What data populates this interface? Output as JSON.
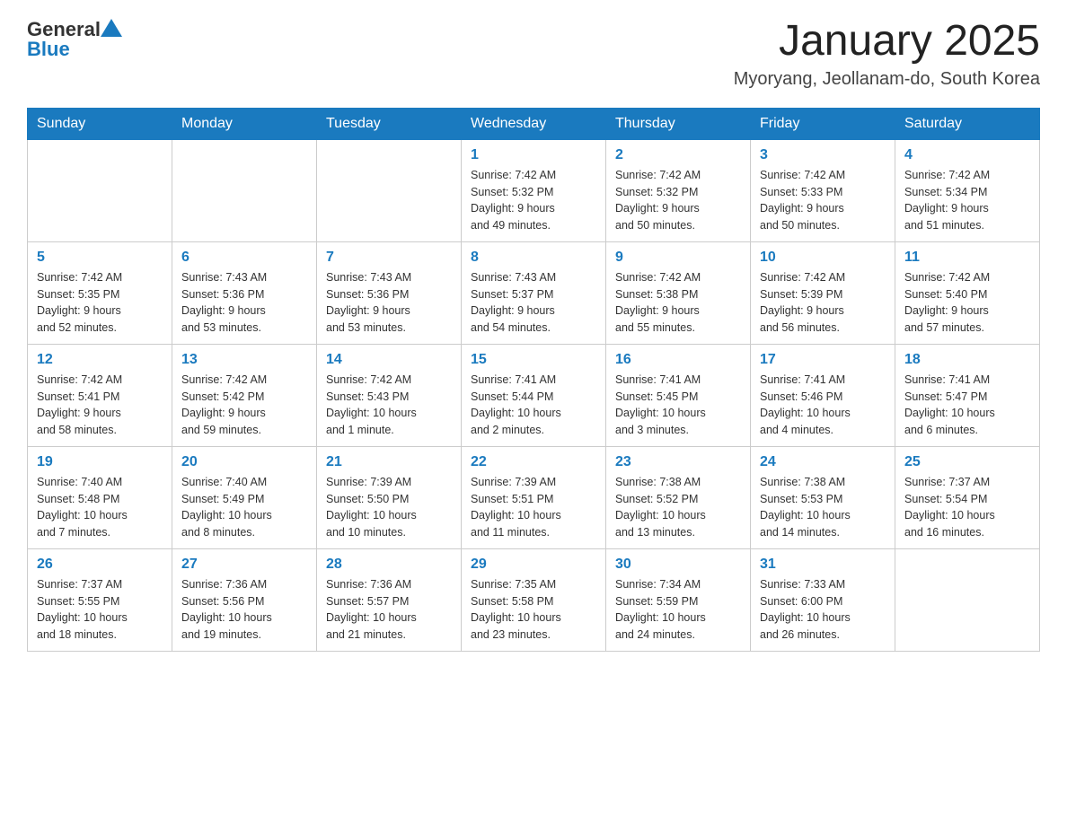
{
  "header": {
    "logo": {
      "general": "General",
      "blue": "Blue"
    },
    "title": "January 2025",
    "location": "Myoryang, Jeollanam-do, South Korea"
  },
  "weekdays": [
    "Sunday",
    "Monday",
    "Tuesday",
    "Wednesday",
    "Thursday",
    "Friday",
    "Saturday"
  ],
  "weeks": [
    [
      {
        "day": "",
        "info": ""
      },
      {
        "day": "",
        "info": ""
      },
      {
        "day": "",
        "info": ""
      },
      {
        "day": "1",
        "info": "Sunrise: 7:42 AM\nSunset: 5:32 PM\nDaylight: 9 hours\nand 49 minutes."
      },
      {
        "day": "2",
        "info": "Sunrise: 7:42 AM\nSunset: 5:32 PM\nDaylight: 9 hours\nand 50 minutes."
      },
      {
        "day": "3",
        "info": "Sunrise: 7:42 AM\nSunset: 5:33 PM\nDaylight: 9 hours\nand 50 minutes."
      },
      {
        "day": "4",
        "info": "Sunrise: 7:42 AM\nSunset: 5:34 PM\nDaylight: 9 hours\nand 51 minutes."
      }
    ],
    [
      {
        "day": "5",
        "info": "Sunrise: 7:42 AM\nSunset: 5:35 PM\nDaylight: 9 hours\nand 52 minutes."
      },
      {
        "day": "6",
        "info": "Sunrise: 7:43 AM\nSunset: 5:36 PM\nDaylight: 9 hours\nand 53 minutes."
      },
      {
        "day": "7",
        "info": "Sunrise: 7:43 AM\nSunset: 5:36 PM\nDaylight: 9 hours\nand 53 minutes."
      },
      {
        "day": "8",
        "info": "Sunrise: 7:43 AM\nSunset: 5:37 PM\nDaylight: 9 hours\nand 54 minutes."
      },
      {
        "day": "9",
        "info": "Sunrise: 7:42 AM\nSunset: 5:38 PM\nDaylight: 9 hours\nand 55 minutes."
      },
      {
        "day": "10",
        "info": "Sunrise: 7:42 AM\nSunset: 5:39 PM\nDaylight: 9 hours\nand 56 minutes."
      },
      {
        "day": "11",
        "info": "Sunrise: 7:42 AM\nSunset: 5:40 PM\nDaylight: 9 hours\nand 57 minutes."
      }
    ],
    [
      {
        "day": "12",
        "info": "Sunrise: 7:42 AM\nSunset: 5:41 PM\nDaylight: 9 hours\nand 58 minutes."
      },
      {
        "day": "13",
        "info": "Sunrise: 7:42 AM\nSunset: 5:42 PM\nDaylight: 9 hours\nand 59 minutes."
      },
      {
        "day": "14",
        "info": "Sunrise: 7:42 AM\nSunset: 5:43 PM\nDaylight: 10 hours\nand 1 minute."
      },
      {
        "day": "15",
        "info": "Sunrise: 7:41 AM\nSunset: 5:44 PM\nDaylight: 10 hours\nand 2 minutes."
      },
      {
        "day": "16",
        "info": "Sunrise: 7:41 AM\nSunset: 5:45 PM\nDaylight: 10 hours\nand 3 minutes."
      },
      {
        "day": "17",
        "info": "Sunrise: 7:41 AM\nSunset: 5:46 PM\nDaylight: 10 hours\nand 4 minutes."
      },
      {
        "day": "18",
        "info": "Sunrise: 7:41 AM\nSunset: 5:47 PM\nDaylight: 10 hours\nand 6 minutes."
      }
    ],
    [
      {
        "day": "19",
        "info": "Sunrise: 7:40 AM\nSunset: 5:48 PM\nDaylight: 10 hours\nand 7 minutes."
      },
      {
        "day": "20",
        "info": "Sunrise: 7:40 AM\nSunset: 5:49 PM\nDaylight: 10 hours\nand 8 minutes."
      },
      {
        "day": "21",
        "info": "Sunrise: 7:39 AM\nSunset: 5:50 PM\nDaylight: 10 hours\nand 10 minutes."
      },
      {
        "day": "22",
        "info": "Sunrise: 7:39 AM\nSunset: 5:51 PM\nDaylight: 10 hours\nand 11 minutes."
      },
      {
        "day": "23",
        "info": "Sunrise: 7:38 AM\nSunset: 5:52 PM\nDaylight: 10 hours\nand 13 minutes."
      },
      {
        "day": "24",
        "info": "Sunrise: 7:38 AM\nSunset: 5:53 PM\nDaylight: 10 hours\nand 14 minutes."
      },
      {
        "day": "25",
        "info": "Sunrise: 7:37 AM\nSunset: 5:54 PM\nDaylight: 10 hours\nand 16 minutes."
      }
    ],
    [
      {
        "day": "26",
        "info": "Sunrise: 7:37 AM\nSunset: 5:55 PM\nDaylight: 10 hours\nand 18 minutes."
      },
      {
        "day": "27",
        "info": "Sunrise: 7:36 AM\nSunset: 5:56 PM\nDaylight: 10 hours\nand 19 minutes."
      },
      {
        "day": "28",
        "info": "Sunrise: 7:36 AM\nSunset: 5:57 PM\nDaylight: 10 hours\nand 21 minutes."
      },
      {
        "day": "29",
        "info": "Sunrise: 7:35 AM\nSunset: 5:58 PM\nDaylight: 10 hours\nand 23 minutes."
      },
      {
        "day": "30",
        "info": "Sunrise: 7:34 AM\nSunset: 5:59 PM\nDaylight: 10 hours\nand 24 minutes."
      },
      {
        "day": "31",
        "info": "Sunrise: 7:33 AM\nSunset: 6:00 PM\nDaylight: 10 hours\nand 26 minutes."
      },
      {
        "day": "",
        "info": ""
      }
    ]
  ]
}
